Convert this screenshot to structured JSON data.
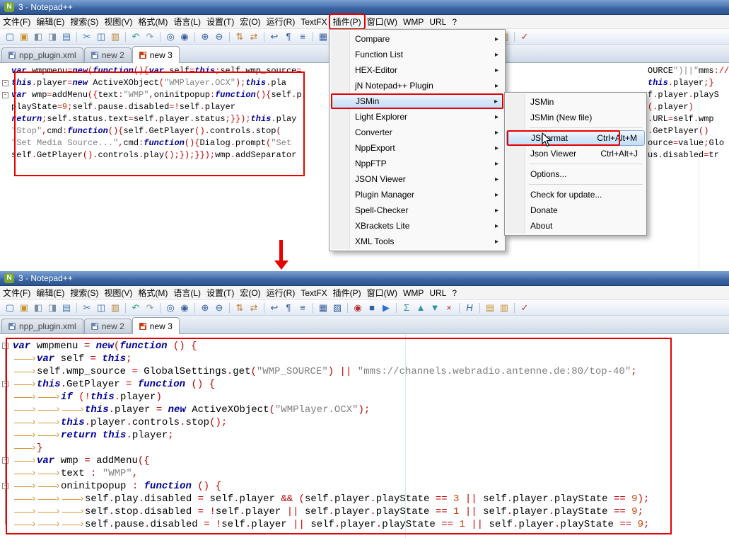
{
  "title": "3 - Notepad++",
  "annotations": {
    "color": "#e60000"
  },
  "menu_bar": {
    "items": [
      {
        "name": "file",
        "label": "文件(F)"
      },
      {
        "name": "edit",
        "label": "编辑(E)"
      },
      {
        "name": "search",
        "label": "搜索(S)"
      },
      {
        "name": "view",
        "label": "视图(V)"
      },
      {
        "name": "format",
        "label": "格式(M)"
      },
      {
        "name": "language",
        "label": "语言(L)"
      },
      {
        "name": "settings",
        "label": "设置(T)"
      },
      {
        "name": "macro",
        "label": "宏(O)"
      },
      {
        "name": "run",
        "label": "运行(R)"
      },
      {
        "name": "textfx",
        "label": "TextFX"
      },
      {
        "name": "plugins",
        "label": "插件(P)",
        "annotated": true
      },
      {
        "name": "window",
        "label": "窗口(W)"
      },
      {
        "name": "wmp",
        "label": "WMP"
      },
      {
        "name": "url",
        "label": "URL"
      },
      {
        "name": "help",
        "label": "?"
      }
    ]
  },
  "toolbar": {
    "groups": [
      [
        {
          "name": "new-file",
          "glyph": "▢",
          "color": "#3f6fb5"
        },
        {
          "name": "open-folder",
          "glyph": "▣",
          "color": "#c8912f"
        },
        {
          "name": "save",
          "glyph": "◧",
          "color": "#7d8da0"
        },
        {
          "name": "save-all",
          "glyph": "◨",
          "color": "#7d8da0"
        },
        {
          "name": "print",
          "glyph": "▤",
          "color": "#4f7fae"
        }
      ],
      [
        {
          "name": "cut",
          "glyph": "✂",
          "color": "#3f6fb5"
        },
        {
          "name": "copy",
          "glyph": "◫",
          "color": "#3f6fb5"
        },
        {
          "name": "paste",
          "glyph": "▥",
          "color": "#b8873b"
        }
      ],
      [
        {
          "name": "undo",
          "glyph": "↶",
          "color": "#2e9e86"
        },
        {
          "name": "redo",
          "glyph": "↷",
          "color": "#8a98a8"
        }
      ],
      [
        {
          "name": "find",
          "glyph": "◎",
          "color": "#3a5f9e"
        },
        {
          "name": "replace",
          "glyph": "◉",
          "color": "#3a5f9e"
        }
      ],
      [
        {
          "name": "zoom-in",
          "glyph": "⊕",
          "color": "#3a5f9e"
        },
        {
          "name": "zoom-out",
          "glyph": "⊖",
          "color": "#3a5f9e"
        }
      ],
      [
        {
          "name": "sync-scroll-vertical",
          "glyph": "⇅",
          "color": "#c07a2e"
        },
        {
          "name": "sync-scroll-horizontal",
          "glyph": "⇄",
          "color": "#c07a2e"
        }
      ],
      [
        {
          "name": "word-wrap",
          "glyph": "↩",
          "color": "#3a5f9e"
        },
        {
          "name": "show-all-characters",
          "glyph": "¶",
          "color": "#3a5f9e"
        },
        {
          "name": "indent-guide",
          "glyph": "≡",
          "color": "#3a5f9e"
        }
      ],
      [
        {
          "name": "user-dialog",
          "glyph": "▦",
          "color": "#3a5f9e"
        },
        {
          "name": "doc-map",
          "glyph": "▧",
          "color": "#3a5f9e"
        }
      ],
      [
        {
          "name": "macro-record",
          "glyph": "◉",
          "color": "#b03030"
        },
        {
          "name": "macro-stop",
          "glyph": "■",
          "color": "#33619e"
        },
        {
          "name": "macro-play",
          "glyph": "▶",
          "color": "#2e6fd6"
        }
      ],
      [
        {
          "name": "textfx-sum",
          "glyph": "Σ",
          "color": "#2e8f9e"
        },
        {
          "name": "sort-ascending",
          "glyph": "▲",
          "color": "#2e8f9e"
        },
        {
          "name": "sort-descending",
          "glyph": "▼",
          "color": "#2e8f9e"
        },
        {
          "name": "clear",
          "glyph": "×",
          "color": "#c03030"
        }
      ],
      [
        {
          "name": "function-help",
          "glyph": "H",
          "color": "#305f9e",
          "italic": true
        }
      ],
      [
        {
          "name": "export-html",
          "glyph": "▤",
          "color": "#c8912f"
        },
        {
          "name": "export-rtf",
          "glyph": "▥",
          "color": "#c8912f"
        }
      ],
      [
        {
          "name": "spell-check",
          "glyph": "✓",
          "color": "#b03020"
        }
      ]
    ]
  },
  "tabs": [
    {
      "name": "tab-npp-plugin-xml",
      "label": "npp_plugin.xml",
      "active": false,
      "disk": "#6b86ad"
    },
    {
      "name": "tab-new-2",
      "label": "new 2",
      "active": false,
      "disk": "#6b86ad"
    },
    {
      "name": "tab-new-3",
      "label": "new 3",
      "active": true,
      "disk": "#d03c10"
    }
  ],
  "top_editor": {
    "folds": [
      2,
      3
    ],
    "lines": [
      {
        "left": "var wmpmenu=new(function(){var self=this;self.wmp_source=",
        "right": "OURCE\")||\"mms://channels.webradio.antenne.de:"
      },
      {
        "left": "this.player=new ActiveXObject(\"WMPlayer.OCX\");this.pla",
        "right": "this.player;}"
      },
      {
        "left": "var wmp=addMenu({text:\"WMP\",oninitpopup:function(){self.p",
        "right": "f.player.playS"
      },
      {
        "left": "playState=9;self.pause.disabled=!self.player",
        "right": "(.player)"
      },
      {
        "left": "return;self.status.text=self.player.status;}});this.play",
        "right": ".URL=self.wmp"
      },
      {
        "left": "\"Stop\",cmd:function(){self.GetPlayer().controls.stop(",
        "right": ".GetPlayer()"
      },
      {
        "left": "\"Set Media Source...\",cmd:function(){Dialog.prompt(\"Set",
        "right": "ource=value;Glo"
      },
      {
        "left": "self.GetPlayer().controls.play();});}});wmp.addSeparator",
        "right": "us.disabled=tr"
      }
    ]
  },
  "bottom_editor": {
    "folds": [
      1,
      4,
      10,
      12
    ],
    "lines": [
      "var wmpmenu = new(function () {",
      "\tvar self = this;",
      "\tself.wmp_source = GlobalSettings.get(\"WMP_SOURCE\") || \"mms://channels.webradio.antenne.de:80/top-40\";",
      "\tthis.GetPlayer = function () {",
      "\t\tif (!this.player)",
      "\t\t\tthis.player = new ActiveXObject(\"WMPlayer.OCX\");",
      "\t\tthis.player.controls.stop();",
      "\t\treturn this.player;",
      "\t}",
      "\tvar wmp = addMenu({",
      "\t\ttext : \"WMP\",",
      "\t\toninitpopup : function () {",
      "\t\t\tself.play.disabled = self.player && (self.player.playState == 3 || self.player.playState == 9);",
      "\t\t\tself.stop.disabled = !self.player || self.player.playState == 1 || self.player.playState == 9;",
      "\t\t\tself.pause.disabled = !self.player || self.player.playState == 1 || self.player.playState == 9;"
    ]
  },
  "plugins_menu": {
    "items": [
      {
        "name": "compare",
        "label": "Compare",
        "submenu": true
      },
      {
        "name": "function-list",
        "label": "Function List",
        "submenu": true
      },
      {
        "name": "hex-editor",
        "label": "HEX-Editor",
        "submenu": true
      },
      {
        "name": "jn-plugin",
        "label": "jN Notepad++ Plugin",
        "submenu": true
      },
      {
        "name": "jsmin",
        "label": "JSMin",
        "submenu": true,
        "highlighted": true,
        "annotated": true
      },
      {
        "name": "light-explorer",
        "label": "Light Explorer",
        "submenu": true
      },
      {
        "name": "converter",
        "label": "Converter",
        "submenu": true
      },
      {
        "name": "nppexport",
        "label": "NppExport",
        "submenu": true
      },
      {
        "name": "nppftp",
        "label": "NppFTP",
        "submenu": true
      },
      {
        "name": "json-viewer",
        "label": "JSON Viewer",
        "submenu": true
      },
      {
        "name": "plugin-manager",
        "label": "Plugin Manager",
        "submenu": true
      },
      {
        "name": "spell-checker",
        "label": "Spell-Checker",
        "submenu": true
      },
      {
        "name": "xbrackets-lite",
        "label": "XBrackets Lite",
        "submenu": true
      },
      {
        "name": "xml-tools",
        "label": "XML Tools",
        "submenu": true
      }
    ]
  },
  "jsmin_submenu": {
    "items": [
      {
        "name": "jsmin",
        "label": "JSMin"
      },
      {
        "name": "jsmin-new-file",
        "label": "JSMin (New file)"
      },
      {
        "sep": true
      },
      {
        "name": "jsformat",
        "label": "JSFormat",
        "shortcut": "Ctrl+Alt+M",
        "highlighted": true,
        "annotated": true
      },
      {
        "name": "json-viewer",
        "label": "Json Viewer",
        "shortcut": "Ctrl+Alt+J"
      },
      {
        "sep": true
      },
      {
        "name": "options",
        "label": "Options..."
      },
      {
        "sep": true
      },
      {
        "name": "check-for-update",
        "label": "Check for update..."
      },
      {
        "name": "donate",
        "label": "Donate"
      },
      {
        "name": "about",
        "label": "About"
      }
    ]
  }
}
